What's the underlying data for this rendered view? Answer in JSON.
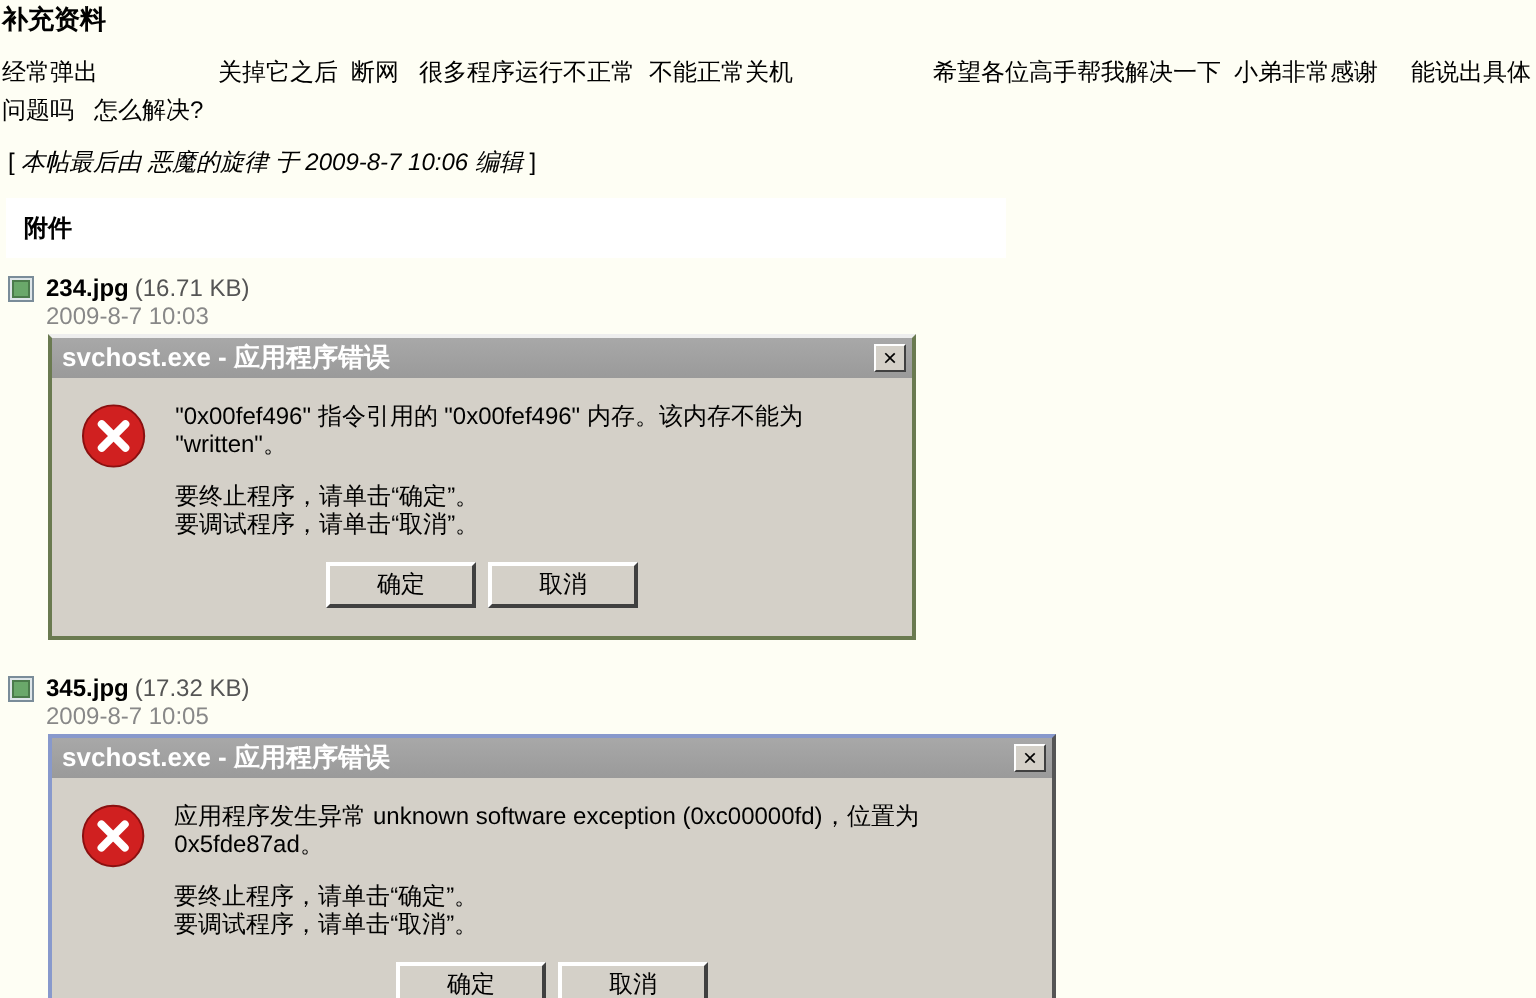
{
  "post": {
    "heading": "补充资料",
    "body": "经常弹出                  关掉它之后  断网   很多程序运行不正常  不能正常关机                     希望各位高手帮我解决一下  小弟非常感谢     能说出具体问题吗   怎么解决?",
    "edit_note": "[ *本帖最后由  恶魔的旋律  于  2009-8-7 10:06  编辑* ]"
  },
  "attachments": {
    "heading": "附件",
    "items": [
      {
        "filename": "234.jpg",
        "size": "(16.71 KB)",
        "date": "2009-8-7 10:03",
        "dialog": {
          "title": "svchost.exe - 应用程序错误",
          "message": "\"0x00fef496\" 指令引用的 \"0x00fef496\" 内存。该内存不能为 \"written\"。",
          "hint_1": "要终止程序，请单击“确定”。",
          "hint_2": "要调试程序，请单击“取消”。",
          "buttons": [
            "确定",
            "取消"
          ],
          "close": "×"
        }
      },
      {
        "filename": "345.jpg",
        "size": "(17.32 KB)",
        "date": "2009-8-7 10:05",
        "dialog": {
          "title": "svchost.exe - 应用程序错误",
          "message": "应用程序发生异常 unknown software exception (0xc00000fd)，位置为 0x5fde87ad。",
          "hint_1": "要终止程序，请单击“确定”。",
          "hint_2": "要调试程序，请单击“取消”。",
          "buttons": [
            "确定",
            "取消"
          ],
          "close": "×"
        }
      }
    ]
  }
}
